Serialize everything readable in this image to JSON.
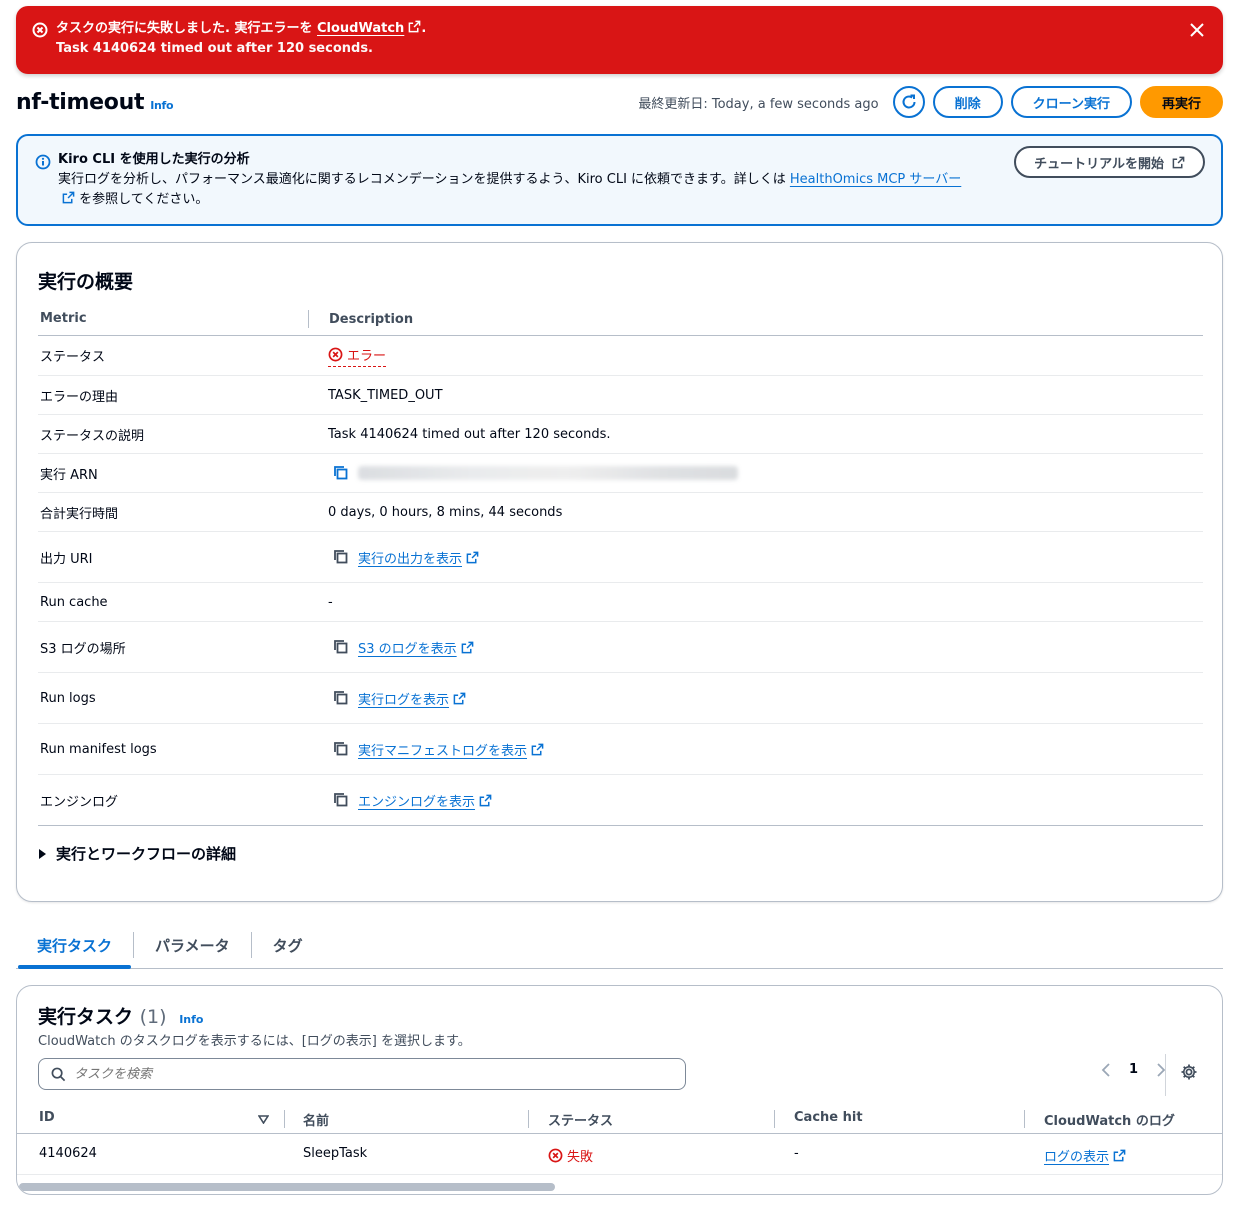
{
  "flash": {
    "title_prefix": "タスクの実行に失敗しました. 実行エラーを",
    "title_link": "CloudWatch",
    "title_suffix": ".",
    "message": "Task 4140624 timed out after 120 seconds."
  },
  "header": {
    "title": "nf-timeout",
    "info": "Info",
    "last_updated": "最終更新日: Today, a few seconds ago",
    "delete_label": "削除",
    "clone_label": "クローン実行",
    "rerun_label": "再実行"
  },
  "alert": {
    "title": "Kiro CLI を使用した実行の分析",
    "body_prefix": "実行ログを分析し、パフォーマンス最適化に関するレコメンデーションを提供するよう、Kiro CLI に依頼できます。詳しくは",
    "body_link": "HealthOmics MCP サーバー",
    "body_suffix": "を参照してください。",
    "button_label": "チュートリアルを開始"
  },
  "summary": {
    "title": "実行の概要",
    "col_metric": "Metric",
    "col_description": "Description",
    "rows": {
      "status": {
        "label": "ステータス",
        "value": "エラー"
      },
      "error_reason": {
        "label": "エラーの理由",
        "value": "TASK_TIMED_OUT"
      },
      "status_desc": {
        "label": "ステータスの説明",
        "value": "Task 4140624 timed out after 120 seconds."
      },
      "arn": {
        "label": "実行 ARN"
      },
      "duration": {
        "label": "合計実行時間",
        "value": "0 days, 0 hours, 8 mins, 44 seconds"
      },
      "output_uri": {
        "label": "出力 URI",
        "link": "実行の出力を表示"
      },
      "run_cache": {
        "label": "Run cache",
        "value": "-"
      },
      "s3_logs": {
        "label": "S3 ログの場所",
        "link": "S3 のログを表示"
      },
      "run_logs": {
        "label": "Run logs",
        "link": "実行ログを表示"
      },
      "manifest_logs": {
        "label": "Run manifest logs",
        "link": "実行マニフェストログを表示"
      },
      "engine_logs": {
        "label": "エンジンログ",
        "link": "エンジンログを表示"
      }
    },
    "expander": "実行とワークフローの詳細"
  },
  "tabs": [
    "実行タスク",
    "パラメータ",
    "タグ"
  ],
  "tasks": {
    "title": "実行タスク",
    "count": "(1)",
    "info": "Info",
    "description": "CloudWatch のタスクログを表示するには、[ログの表示] を選択します。",
    "search_placeholder": "タスクを検索",
    "page": "1",
    "columns": [
      "ID",
      "名前",
      "ステータス",
      "Cache hit",
      "CloudWatch のログ"
    ],
    "rows": [
      {
        "id": "4140624",
        "name": "SleepTask",
        "status": "失敗",
        "cache_hit": "-",
        "log_link": "ログの表示"
      }
    ]
  },
  "colors": {
    "error": "#d91515",
    "link": "#0972d3",
    "primary": "#ff9900",
    "info_bg": "#f2f8fd"
  }
}
